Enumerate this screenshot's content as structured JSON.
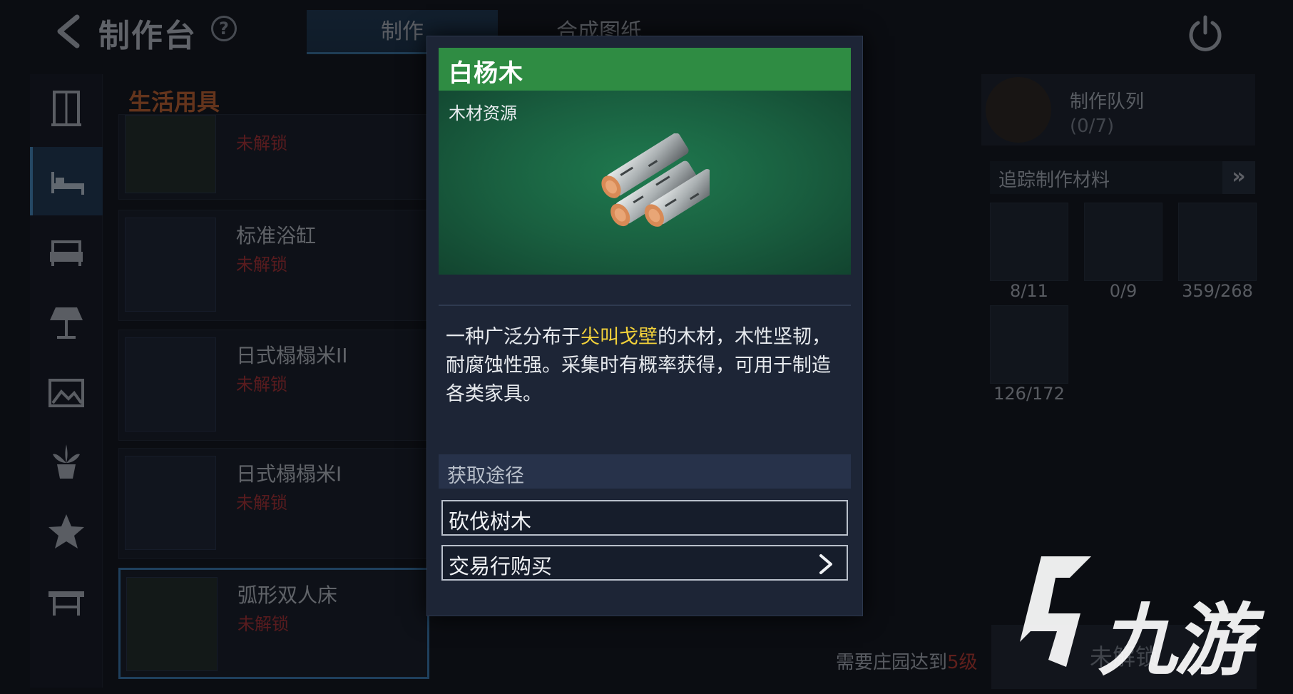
{
  "header": {
    "title": "制作台",
    "help_glyph": "?",
    "tabs": [
      {
        "label": "制作",
        "active": true
      },
      {
        "label": "合成图纸",
        "active": false
      }
    ]
  },
  "sidebar": {
    "categories": [
      {
        "icon": "wardrobe-icon",
        "active": false
      },
      {
        "icon": "bed-icon",
        "active": true
      },
      {
        "icon": "sofa-icon",
        "active": false
      },
      {
        "icon": "lamp-icon",
        "active": false
      },
      {
        "icon": "picture-frame-icon",
        "active": false
      },
      {
        "icon": "potted-plant-icon",
        "active": false
      },
      {
        "icon": "star-icon",
        "active": false
      },
      {
        "icon": "table-icon",
        "active": false
      }
    ]
  },
  "list": {
    "section_title": "生活用具",
    "items": [
      {
        "name": "",
        "lock": "未解锁",
        "selected": false
      },
      {
        "name": "标准浴缸",
        "lock": "未解锁",
        "selected": false
      },
      {
        "name": "日式榻榻米II",
        "lock": "未解锁",
        "selected": false
      },
      {
        "name": "日式榻榻米I",
        "lock": "未解锁",
        "selected": false
      },
      {
        "name": "弧形双人床",
        "lock": "未解锁",
        "selected": true
      }
    ]
  },
  "right_panel": {
    "queue_title": "制作队列",
    "queue_count": "(0/7)",
    "track_label": "追踪制作材料",
    "track_arrow": "»",
    "materials": [
      {
        "count": "8/11"
      },
      {
        "count": "0/9"
      },
      {
        "count": "359/268"
      },
      {
        "count": "126/172"
      }
    ],
    "requirement_prefix": "需要庄园达到",
    "requirement_level": "5级",
    "unlock_button": "未解锁"
  },
  "tooltip": {
    "name": "白杨木",
    "type": "木材资源",
    "desc_before": "一种广泛分布于",
    "desc_highlight": "尖叫戈壁",
    "desc_after": "的木材，木性坚韧，耐腐蚀性强。采集时有概率获得，可用于制造各类家具。",
    "source_title": "获取途径",
    "sources": [
      {
        "label": "砍伐树木",
        "has_arrow": false
      },
      {
        "label": "交易行购买",
        "has_arrow": true
      }
    ]
  },
  "colors": {
    "header_green": "#2f8c43",
    "highlight_yellow": "#f2d13a",
    "lock_red": "#c23030",
    "active_blue": "#1c3a56"
  },
  "watermark": {
    "text": "九游"
  }
}
